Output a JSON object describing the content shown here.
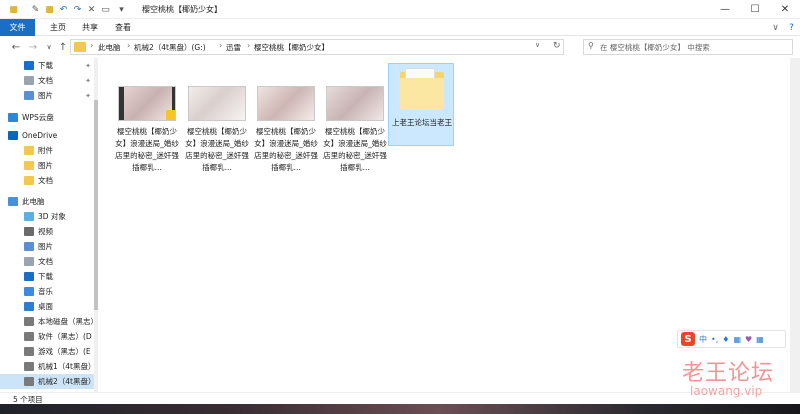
{
  "window": {
    "title": "樱空桃桃【椰奶少女】"
  },
  "ribbon": {
    "tabs": [
      "文件",
      "主页",
      "共享",
      "查看"
    ]
  },
  "address": {
    "crumbs": [
      "此电脑",
      "机械2（4t黑盘）(G:)",
      "迅雷",
      "樱空桃桃【椰奶少女】"
    ]
  },
  "search": {
    "placeholder": "在 樱空桃桃【椰奶少女】 中搜索"
  },
  "sidebar": {
    "items": [
      {
        "label": "下载",
        "icon": "download-icon",
        "color": "#1a6fc4",
        "pinned": true
      },
      {
        "label": "文档",
        "icon": "document-icon",
        "color": "#9aa4b1",
        "pinned": true
      },
      {
        "label": "图片",
        "icon": "pictures-icon",
        "color": "#5a8fd6",
        "pinned": true
      },
      {
        "label": "WPS云盘",
        "icon": "cloud-icon",
        "color": "#2b88d8"
      },
      {
        "label": "OneDrive",
        "icon": "onedrive-icon",
        "color": "#0a64c8"
      },
      {
        "label": "附件",
        "icon": "folder-icon",
        "color": "#f2c94c"
      },
      {
        "label": "图片",
        "icon": "folder-icon",
        "color": "#f2c94c"
      },
      {
        "label": "文档",
        "icon": "folder-icon",
        "color": "#f2c94c"
      },
      {
        "label": "此电脑",
        "icon": "computer-icon",
        "color": "#4a90d9"
      },
      {
        "label": "3D 对象",
        "icon": "3d-objects-icon",
        "color": "#5ab0e0"
      },
      {
        "label": "视频",
        "icon": "videos-icon",
        "color": "#6b6b6b"
      },
      {
        "label": "图片",
        "icon": "pictures-icon",
        "color": "#5a8fd6"
      },
      {
        "label": "文档",
        "icon": "document-icon",
        "color": "#9aa4b1"
      },
      {
        "label": "下载",
        "icon": "download-icon",
        "color": "#1a6fc4"
      },
      {
        "label": "音乐",
        "icon": "music-icon",
        "color": "#3d8be0"
      },
      {
        "label": "桌面",
        "icon": "desktop-icon",
        "color": "#2a7fd1"
      },
      {
        "label": "本地磁盘（黑志）",
        "icon": "drive-icon",
        "color": "#7a7a7a"
      },
      {
        "label": "软件（黑志）(D",
        "icon": "drive-icon",
        "color": "#7a7a7a"
      },
      {
        "label": "游戏（黑志）(E",
        "icon": "drive-icon",
        "color": "#7a7a7a"
      },
      {
        "label": "机械1（4t黑盘）",
        "icon": "drive-icon",
        "color": "#7a7a7a"
      },
      {
        "label": "机械2（4t黑盘）",
        "icon": "drive-icon",
        "color": "#7a7a7a",
        "selected": true
      },
      {
        "label": "机械2（4t黑盘）",
        "icon": "drive-icon",
        "color": "#7a7a7a"
      }
    ]
  },
  "files": [
    {
      "label": "樱空桃桃【椰奶少女】浪漫迷局_婚纱店里的秘密_迷奸强插椰乳...",
      "icon": "video-thumbnail-icon"
    },
    {
      "label": "樱空桃桃【椰奶少女】浪漫迷局_婚纱店里的秘密_迷奸强插椰乳...",
      "icon": "video-thumbnail-icon"
    },
    {
      "label": "樱空桃桃【椰奶少女】浪漫迷局_婚纱店里的秘密_迷奸强插椰乳...",
      "icon": "video-thumbnail-icon"
    },
    {
      "label": "樱空桃桃【椰奶少女】浪漫迷局_婚纱店里的秘密_迷奸强插椰乳...",
      "icon": "video-thumbnail-icon"
    },
    {
      "label": "上老王论坛当老王",
      "icon": "folder-icon"
    }
  ],
  "status": {
    "text": "5 个项目"
  },
  "ime": {
    "label": "中"
  },
  "watermark": {
    "line1": "老王论坛",
    "line2": "laowang.vip"
  },
  "colors": {
    "accent": "#1a6fc4",
    "selection": "#cce8ff"
  }
}
